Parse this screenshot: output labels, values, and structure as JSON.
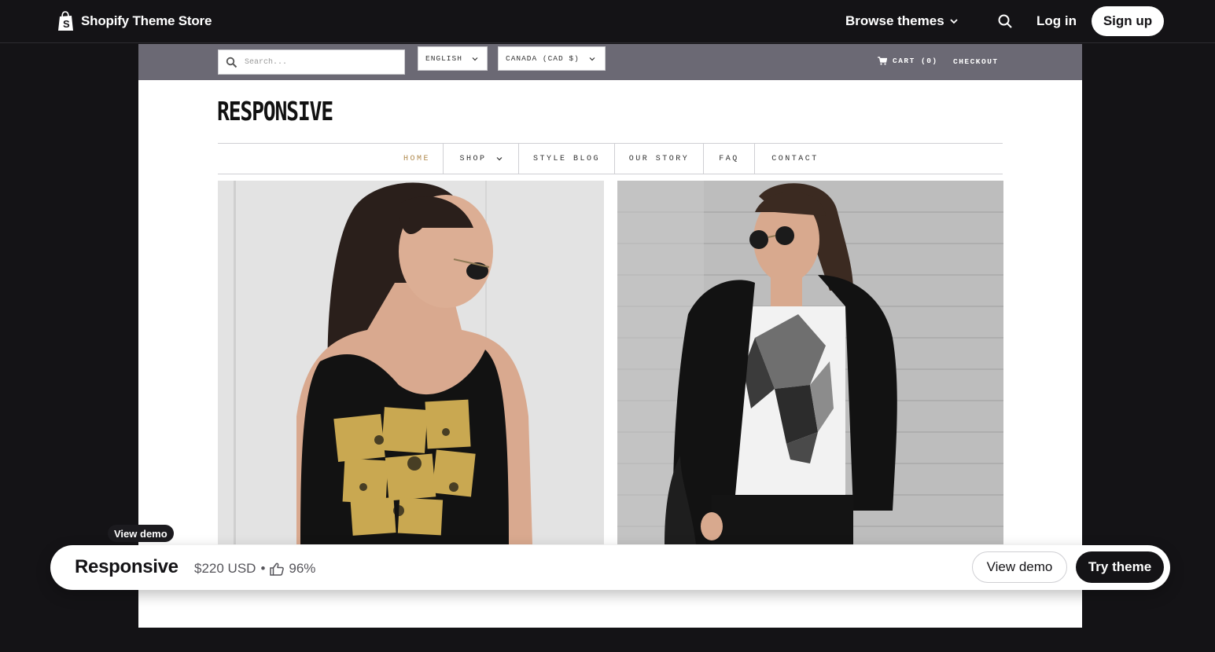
{
  "header": {
    "brand": "Shopify Theme Store",
    "browse_label": "Browse themes",
    "login_label": "Log in",
    "signup_label": "Sign up"
  },
  "demo": {
    "search_placeholder": "Search...",
    "language": "ENGLISH",
    "currency": "CANADA (CAD $)",
    "cart_label": "CART (0)",
    "checkout_label": "CHECKOUT",
    "logo": "RESPONSIVE",
    "nav": [
      {
        "label": "HOME",
        "active": true
      },
      {
        "label": "SHOP",
        "dropdown": true
      },
      {
        "label": "STYLE BLOG"
      },
      {
        "label": "OUR STORY"
      },
      {
        "label": "FAQ"
      },
      {
        "label": "CONTACT"
      }
    ]
  },
  "footer": {
    "tooltip": "View demo",
    "theme_name": "Responsive",
    "price": "$220 USD",
    "separator": "•",
    "rating": "96%",
    "view_demo_label": "View demo",
    "try_theme_label": "Try theme"
  },
  "colors": {
    "dark": "#141316",
    "demo_topbar": "#6b6974",
    "nav_active": "#b08a4e"
  },
  "icons": [
    "shopify-bag-icon",
    "chevron-down-icon",
    "search-icon",
    "cart-icon",
    "thumbs-up-icon"
  ]
}
